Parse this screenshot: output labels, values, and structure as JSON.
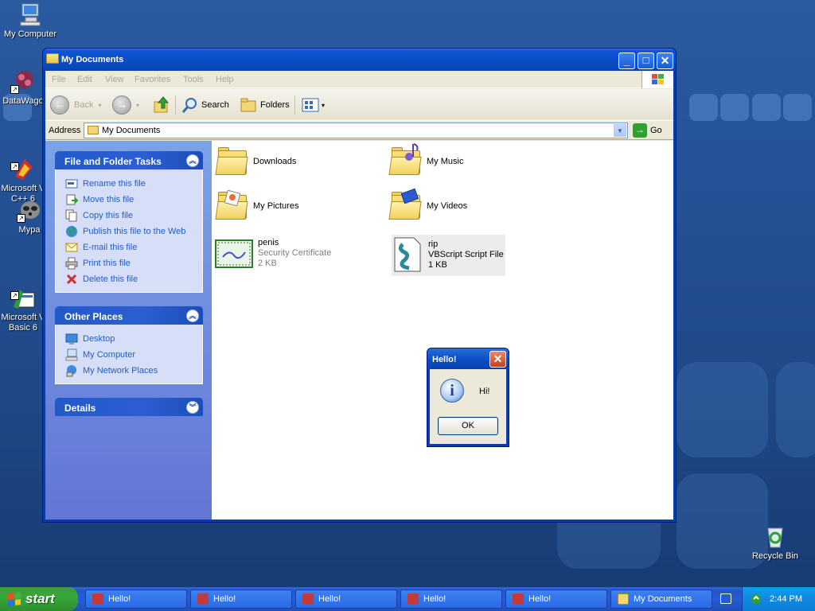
{
  "desktop": {
    "icons": [
      {
        "label": "My Computer"
      },
      {
        "label": "DataWago"
      },
      {
        "label": "Microsoft V\nC++ 6"
      },
      {
        "label": "Mypa"
      },
      {
        "label": "Microsoft V\nBasic 6"
      },
      {
        "label": "Recycle Bin"
      }
    ]
  },
  "window": {
    "title": "My Documents",
    "controls": {
      "minimize": "_",
      "maximize": "□",
      "close": "✕"
    },
    "menu": [
      "File",
      "Edit",
      "View",
      "Favorites",
      "Tools",
      "Help"
    ],
    "toolbar": {
      "back": "Back",
      "search": "Search",
      "folders": "Folders"
    },
    "address": {
      "label": "Address",
      "value": "My Documents",
      "go": "Go"
    },
    "tasks": {
      "file_folder": {
        "title": "File and Folder Tasks",
        "links": [
          "Rename this file",
          "Move this file",
          "Copy this file",
          "Publish this file to the Web",
          "E-mail this file",
          "Print this file",
          "Delete this file"
        ]
      },
      "other_places": {
        "title": "Other Places",
        "links": [
          "Desktop",
          "My Computer",
          "My Network Places"
        ]
      },
      "details": {
        "title": "Details"
      }
    },
    "items": [
      {
        "name": "Downloads"
      },
      {
        "name": "My Music"
      },
      {
        "name": "My Pictures"
      },
      {
        "name": "My Videos"
      },
      {
        "name": "penis",
        "type": "Security Certificate",
        "size": "2 KB"
      },
      {
        "name": "rip",
        "type": "VBScript Script File",
        "size": "1 KB"
      }
    ]
  },
  "dialog": {
    "title": "Hello!",
    "message": "Hi!",
    "ok": "OK",
    "close": "✕"
  },
  "taskbar": {
    "start": "start",
    "tasks": [
      "Hello!",
      "Hello!",
      "Hello!",
      "Hello!",
      "Hello!",
      "My Documents"
    ],
    "clock": "2:44 PM"
  }
}
